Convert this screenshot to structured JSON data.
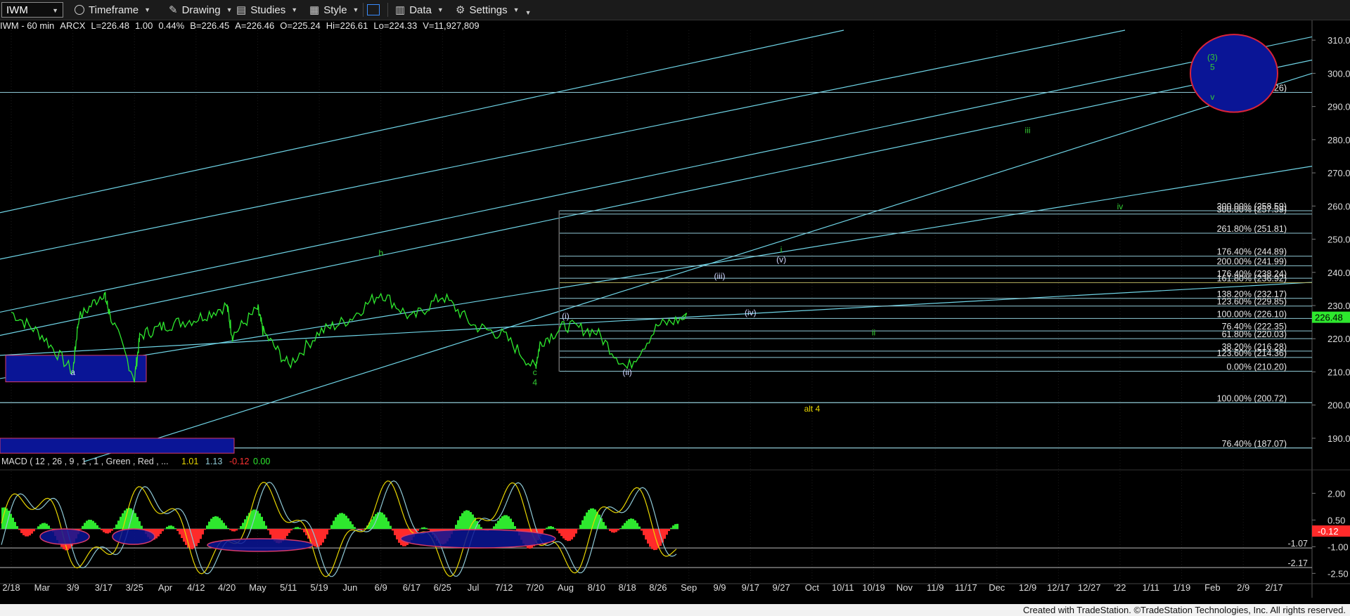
{
  "toolbar": {
    "symbol": "IWM",
    "timeframe": "Timeframe",
    "drawing": "Drawing",
    "studies": "Studies",
    "style": "Style",
    "data": "Data",
    "settings": "Settings"
  },
  "status": {
    "symbol_info": "IWM - 60 min",
    "exchange": "ARCX",
    "last": "L=226.48",
    "change": "1.00",
    "pct": "0.44%",
    "bid": "B=226.45",
    "ask": "A=226.46",
    "open": "O=225.24",
    "high": "Hi=226.61",
    "low": "Lo=224.33",
    "volume": "V=11,927,809"
  },
  "footer": "Created with TradeStation. ©TradeStation Technologies, Inc. All rights reserved.",
  "chart_data": [
    {
      "type": "line",
      "panel": "price",
      "color": "#2ee82e",
      "ylim": [
        183,
        313
      ],
      "yticks": [
        190,
        200,
        210,
        220,
        230,
        240,
        250,
        260,
        270,
        280,
        290,
        300,
        310
      ],
      "last_price": "226.48",
      "x_labels": [
        "2/18",
        "Mar",
        "3/9",
        "3/17",
        "3/25",
        "Apr",
        "4/12",
        "4/20",
        "May",
        "5/11",
        "5/19",
        "Jun",
        "6/9",
        "6/17",
        "6/25",
        "Jul",
        "7/12",
        "7/20",
        "Aug",
        "8/10",
        "8/18",
        "8/26",
        "Sep",
        "9/9",
        "9/17",
        "9/27",
        "Oct",
        "10/11",
        "10/19",
        "Nov",
        "11/9",
        "11/17",
        "Dec",
        "12/9",
        "12/17",
        "12/27",
        "'22",
        "1/11",
        "1/19",
        "Feb",
        "2/9",
        "2/17"
      ],
      "series": [
        {
          "values": [
            {
              "x": "2/18",
              "y": 228
            },
            {
              "x": "Mar",
              "y": 221
            },
            {
              "x": "3/9",
              "y": 210
            },
            {
              "x": "3/9",
              "y": 226
            },
            {
              "x": "3/17",
              "y": 234
            },
            {
              "x": "3/17",
              "y": 228
            },
            {
              "x": "3/25",
              "y": 208
            },
            {
              "x": "3/25",
              "y": 221
            },
            {
              "x": "Apr",
              "y": 224
            },
            {
              "x": "4/12",
              "y": 226
            },
            {
              "x": "4/20",
              "y": 230
            },
            {
              "x": "4/20",
              "y": 221
            },
            {
              "x": "May",
              "y": 229
            },
            {
              "x": "May",
              "y": 222
            },
            {
              "x": "5/11",
              "y": 212
            },
            {
              "x": "5/19",
              "y": 222
            },
            {
              "x": "Jun",
              "y": 226
            },
            {
              "x": "6/9",
              "y": 234
            },
            {
              "x": "6/17",
              "y": 226
            },
            {
              "x": "6/25",
              "y": 233
            },
            {
              "x": "Jul",
              "y": 224
            },
            {
              "x": "7/12",
              "y": 221
            },
            {
              "x": "7/20",
              "y": 211
            },
            {
              "x": "7/20",
              "y": 219
            },
            {
              "x": "Aug",
              "y": 224
            },
            {
              "x": "8/10",
              "y": 222
            },
            {
              "x": "8/18",
              "y": 211
            },
            {
              "x": "8/26",
              "y": 224
            },
            {
              "x": "Sep",
              "y": 226.48
            }
          ]
        }
      ],
      "fib_levels": [
        {
          "label": "300.00% (258.59)",
          "value": 258.59
        },
        {
          "label": "300.00% (257.59)",
          "value": 257.59
        },
        {
          "label": "261.80% (251.81)",
          "value": 251.81
        },
        {
          "label": "176.40% (244.89)",
          "value": 244.89
        },
        {
          "label": "200.00% (241.99)",
          "value": 241.99
        },
        {
          "label": "176.40% (238.24)",
          "value": 238.24
        },
        {
          "label": "161.80% (236.92)",
          "value": 236.92
        },
        {
          "label": "138.20% (232.17)",
          "value": 232.17
        },
        {
          "label": "123.60% (229.85)",
          "value": 229.85
        },
        {
          "label": "100.00% (226.10)",
          "value": 226.1
        },
        {
          "label": "76.40% (222.35)",
          "value": 222.35
        },
        {
          "label": "61.80% (220.03)",
          "value": 220.03
        },
        {
          "label": "38.20% (216.28)",
          "value": 216.28
        },
        {
          "label": "123.60% (214.36)",
          "value": 214.36
        },
        {
          "label": "0.00% (210.20)",
          "value": 210.2
        },
        {
          "label": "100.00% (200.72)",
          "value": 200.72
        },
        {
          "label": "76.40% (187.07)",
          "value": 187.07
        },
        {
          "label": "261.80% (294.26)",
          "value": 294.26
        }
      ],
      "wave_labels": [
        {
          "text": "a",
          "x": "3/9",
          "y": 209
        },
        {
          "text": "b",
          "x": "6/9",
          "y": 245
        },
        {
          "text": "c",
          "x": "7/20",
          "y": 209
        },
        {
          "text": "4",
          "x": "7/20",
          "y": 206
        },
        {
          "text": "(i)",
          "x": "Aug",
          "y": 226
        },
        {
          "text": "(ii)",
          "x": "8/18",
          "y": 209
        },
        {
          "text": "(iii)",
          "x": "9/9",
          "y": 238
        },
        {
          "text": "(iv)",
          "x": "9/17",
          "y": 227
        },
        {
          "text": "(v)",
          "x": "9/27",
          "y": 243
        },
        {
          "text": "i",
          "x": "9/27",
          "y": 246
        },
        {
          "text": "ii",
          "x": "10/19",
          "y": 221
        },
        {
          "text": "iii",
          "x": "12/9",
          "y": 282
        },
        {
          "text": "iv",
          "x": "'22",
          "y": 259
        },
        {
          "text": "alt 4",
          "x": "Oct",
          "y": 198
        },
        {
          "text": "(3)",
          "x": "Feb",
          "y": 304
        },
        {
          "text": "5",
          "x": "Feb",
          "y": 301
        },
        {
          "text": "v",
          "x": "Feb",
          "y": 292
        }
      ]
    },
    {
      "type": "line",
      "panel": "indicator",
      "title": "MACD ( 12 , 26 , 9 , 1 , 1 , Green , Red , ...",
      "values_text": [
        "1.01",
        "1.13",
        "-0.12",
        "0.00"
      ],
      "ylim": [
        -3.0,
        3.0
      ],
      "yticks": [
        2.0,
        0.5,
        -1.0,
        -2.5
      ],
      "reference_lines": [
        {
          "label": "-1.07",
          "value": -1.07
        },
        {
          "label": "-2.17",
          "value": -2.17
        }
      ],
      "last_value": "-0.12"
    }
  ]
}
